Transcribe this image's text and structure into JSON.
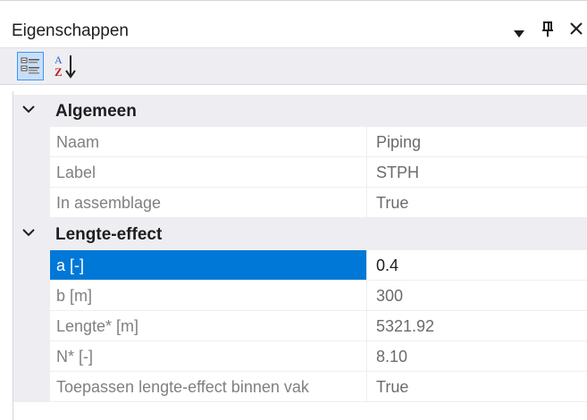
{
  "panel": {
    "title": "Eigenschappen",
    "dropdown_icon": "dropdown-arrow-icon",
    "pin_icon": "pin-icon",
    "close_icon": "close-icon"
  },
  "toolbar": {
    "categorized_icon": "categorized-view-icon",
    "alphabetical_icon": "sort-alphabetical-icon"
  },
  "categories": [
    {
      "label": "Algemeen",
      "expanded": true,
      "properties": [
        {
          "name": "Naam",
          "value": "Piping"
        },
        {
          "name": "Label",
          "value": "STPH"
        },
        {
          "name": "In assemblage",
          "value": "True"
        }
      ]
    },
    {
      "label": "Lengte-effect",
      "expanded": true,
      "properties": [
        {
          "name": "a [-]",
          "value": "0.4",
          "selected": true
        },
        {
          "name": "b [m]",
          "value": "300"
        },
        {
          "name": "Lengte* [m]",
          "value": "5321.92"
        },
        {
          "name": "N* [-]",
          "value": "8.10"
        },
        {
          "name": "Toepassen lengte-effect binnen vak",
          "value": "True"
        }
      ]
    }
  ],
  "colors": {
    "selection": "#0078d7",
    "category_background": "#eeeef2",
    "readonly_text": "#808080"
  }
}
